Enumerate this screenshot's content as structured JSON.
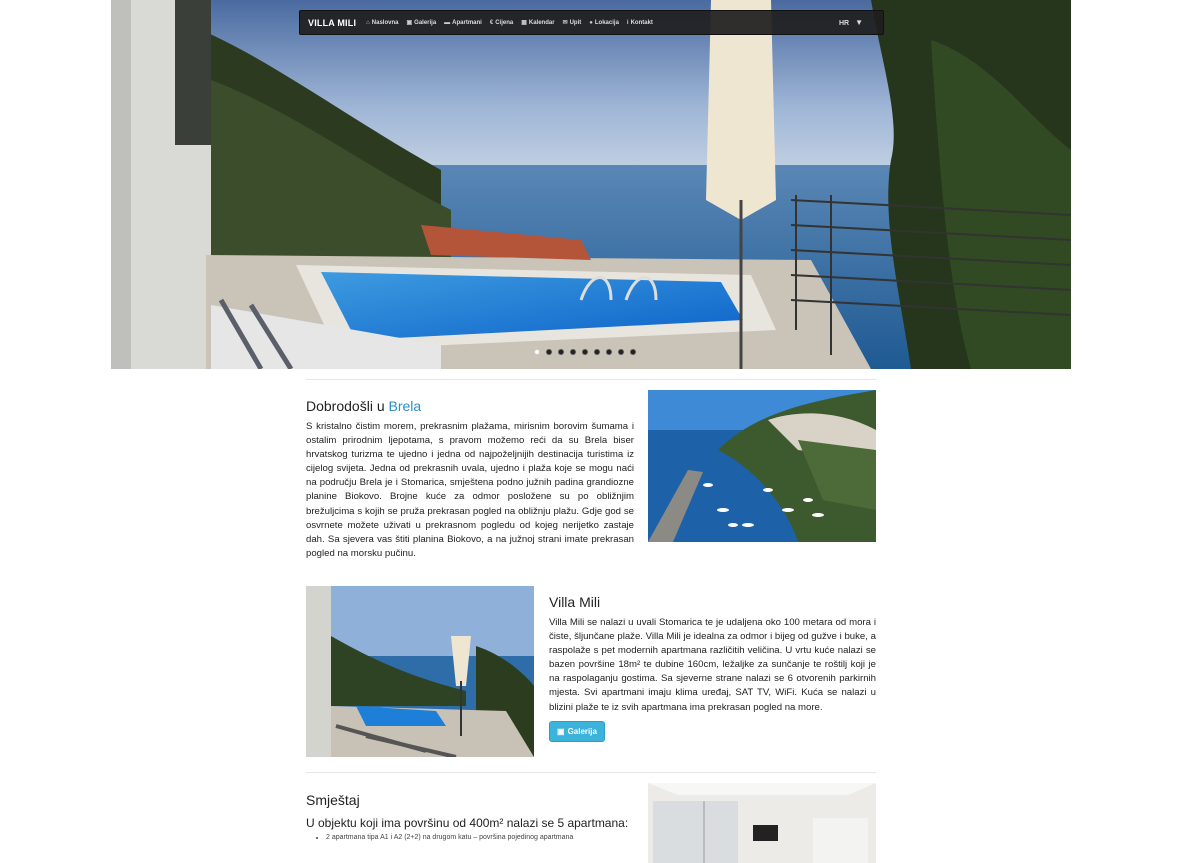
{
  "navbar": {
    "brand": "VILLA MILI",
    "items": [
      {
        "icon": "home-icon",
        "glyph": "⌂",
        "label": "Naslovna"
      },
      {
        "icon": "image-icon",
        "glyph": "▣",
        "label": "Galerija"
      },
      {
        "icon": "bed-icon",
        "glyph": "▬",
        "label": "Apartmani"
      },
      {
        "icon": "euro-icon",
        "glyph": "€",
        "label": "Cijena"
      },
      {
        "icon": "calendar-icon",
        "glyph": "▦",
        "label": "Kalendar"
      },
      {
        "icon": "envelope-icon",
        "glyph": "✉",
        "label": "Upit"
      },
      {
        "icon": "map-marker-icon",
        "glyph": "●",
        "label": "Lokacija"
      },
      {
        "icon": "info-icon",
        "glyph": "i",
        "label": "Kontakt"
      }
    ],
    "language": "HR",
    "language_caret": "▼"
  },
  "carousel": {
    "slide_count": 9,
    "active_index": 0
  },
  "welcome": {
    "title_prefix": "Dobrodošli u ",
    "title_accent": "Brela",
    "text": "S kristalno čistim morem, prekrasnim plažama, mirisnim borovim šumama i ostalim prirodnim ljepotama, s pravom možemo reći da su Brela biser hrvatskog turizma te ujedno i jedna od najpoželjnijih destinacija turistima iz cijelog svijeta. Jedna od prekrasnih uvala, ujedno i plaža koje se mogu naći na području Brela je i Stomarica, smještena podno južnih padina grandiozne planine Biokovo. Brojne kuće za odmor posložene su po obližnjim brežuljcima s kojih se pruža prekrasan pogled na obližnju plažu. Gdje god se osvrnete možete uživati u prekrasnom pogledu od kojeg nerijetko zastaje dah. Sa sjevera vas štiti planina Biokovo, a na južnoj strani imate prekrasan pogled na morsku pučinu."
  },
  "villa": {
    "title": "Villa Mili",
    "text": "Villa Mili se nalazi u uvali Stomarica te je udaljena oko 100 metara od mora i čiste, šljunčane plaže. Villa Mili je idealna za odmor i bijeg od gužve i buke, a raspolaže s pet modernih apartmana različitih veličina. U vrtu kuće nalazi se bazen površine 18m² te dubine 160cm, ležaljke za sunčanje te roštilj koji je na raspolaganju gostima. Sa sjeverne strane nalazi se 6 otvorenih parkirnih mjesta. Svi apartmani imaju klima uređaj, SAT TV, WiFi. Kuća se nalazi u blizini plaže te iz svih apartmana ima prekrasan pogled na more.",
    "button_label": "Galerija"
  },
  "accommodation": {
    "title": "Smještaj",
    "subtitle": "U objektu koji ima površinu od 400m² nalazi se 5 apartmana:",
    "items": [
      "2 apartmana tipa A1 i A2 (2+2) na drugom katu – površina pojedinog apartmana"
    ]
  },
  "colors": {
    "accent": "#2a8fc1",
    "button": "#3bb3db",
    "navbar": "#1e1e1e"
  }
}
